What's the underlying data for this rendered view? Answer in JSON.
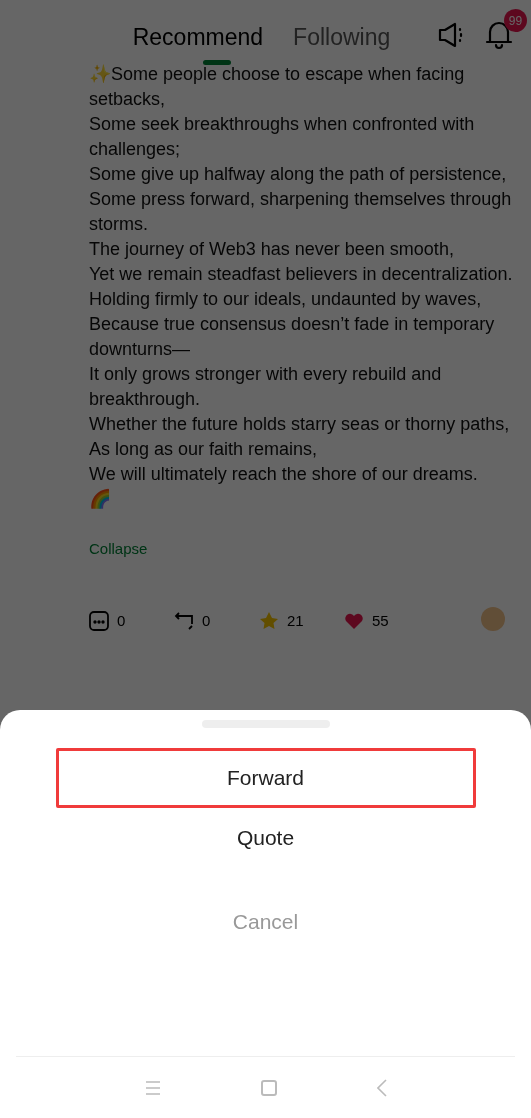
{
  "header": {
    "tabs": [
      {
        "label": "Recommend",
        "selected": true
      },
      {
        "label": "Following",
        "selected": false
      }
    ],
    "notification_badge": "99"
  },
  "post": {
    "lines": [
      "✨Some people choose to escape when facing setbacks,",
      "Some seek breakthroughs when confronted with challenges;",
      "Some give up halfway along the path of persistence,",
      "Some press forward, sharpening themselves through storms.",
      "The journey of Web3 has never been smooth,",
      "Yet we remain steadfast believers in decentralization.",
      "Holding firmly to our ideals, undaunted by waves,",
      "Because true consensus doesn’t fade in temporary downturns—",
      "It only grows stronger with every rebuild and breakthrough.",
      "Whether the future holds starry seas or thorny paths,",
      "As long as our faith remains,",
      "We will ultimately reach the shore of our dreams.",
      "🌈"
    ],
    "collapse_link": "Collapse",
    "stats": [
      {
        "kind": "comment",
        "count": "0"
      },
      {
        "kind": "repost",
        "count": "0"
      },
      {
        "kind": "star",
        "count": "21"
      },
      {
        "kind": "like",
        "count": "55"
      }
    ]
  },
  "sheet": {
    "options": [
      {
        "label": "Forward",
        "kind": "action",
        "highlighted": true
      },
      {
        "label": "Quote",
        "kind": "action",
        "highlighted": false
      },
      {
        "label": "Cancel",
        "kind": "cancel",
        "highlighted": false
      }
    ]
  }
}
